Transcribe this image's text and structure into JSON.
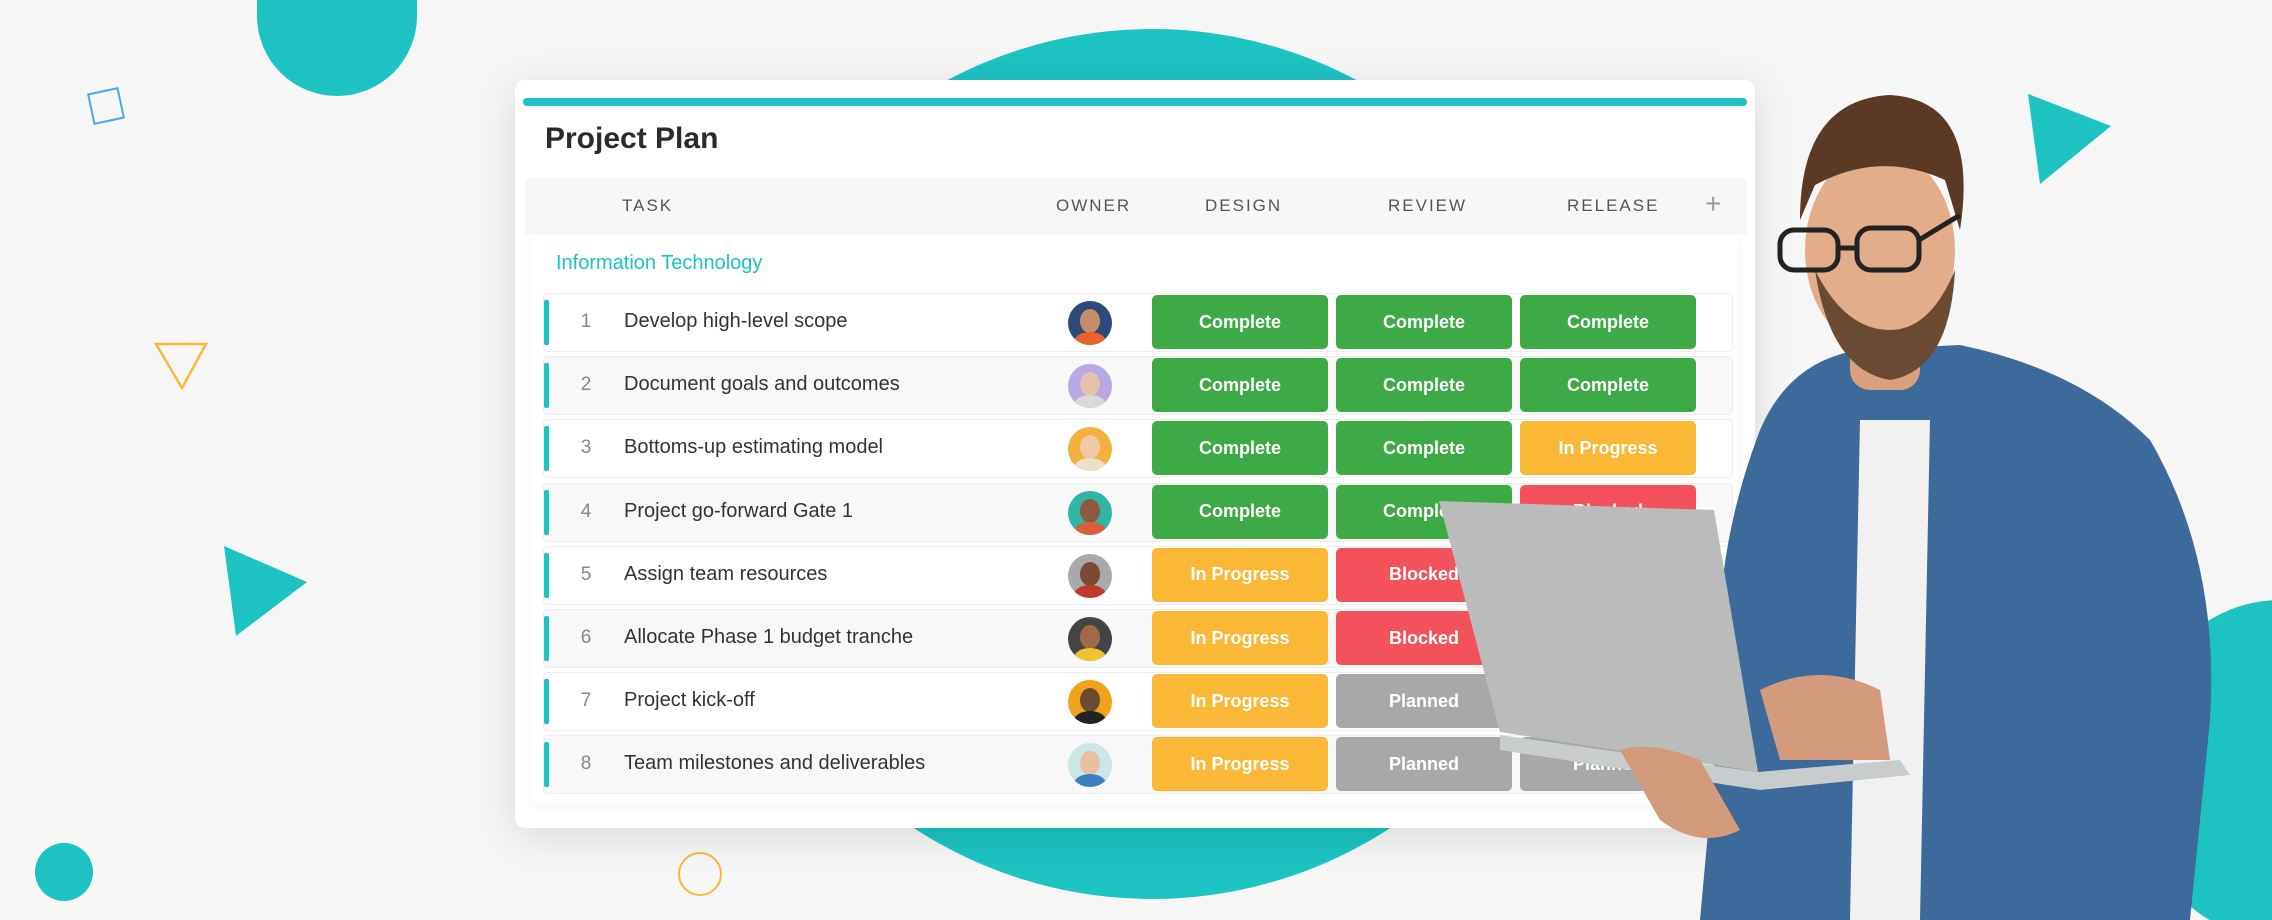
{
  "app": {
    "title": "Project Plan"
  },
  "colors": {
    "accent": "#1dc3c3",
    "complete": "#3daa45",
    "in_progress": "#fbb836",
    "blocked": "#f4525a",
    "planned": "#a8a8a8"
  },
  "columns": {
    "task": "TASK",
    "owner": "OWNER",
    "design": "DESIGN",
    "review": "REVIEW",
    "release": "RELEASE",
    "add_icon": "plus-icon"
  },
  "group": {
    "label": "Information Technology"
  },
  "rows": [
    {
      "num": "1",
      "task": "Develop high-level scope",
      "design": "Complete",
      "review": "Complete",
      "release": "Complete"
    },
    {
      "num": "2",
      "task": "Document goals and outcomes",
      "design": "Complete",
      "review": "Complete",
      "release": "Complete"
    },
    {
      "num": "3",
      "task": "Bottoms-up estimating model",
      "design": "Complete",
      "review": "Complete",
      "release": "In Progress"
    },
    {
      "num": "4",
      "task": "Project go-forward Gate 1",
      "design": "Complete",
      "review": "Complete",
      "release": "Blocked"
    },
    {
      "num": "5",
      "task": "Assign team resources",
      "design": "In Progress",
      "review": "Blocked",
      "release": null
    },
    {
      "num": "6",
      "task": "Allocate Phase 1 budget tranche",
      "design": "In Progress",
      "review": "Blocked",
      "release": null
    },
    {
      "num": "7",
      "task": "Project kick-off",
      "design": "In Progress",
      "review": "Planned",
      "release": null
    },
    {
      "num": "8",
      "task": "Team milestones and deliverables",
      "design": "In Progress",
      "review": "Planned",
      "release": "Planned"
    }
  ]
}
